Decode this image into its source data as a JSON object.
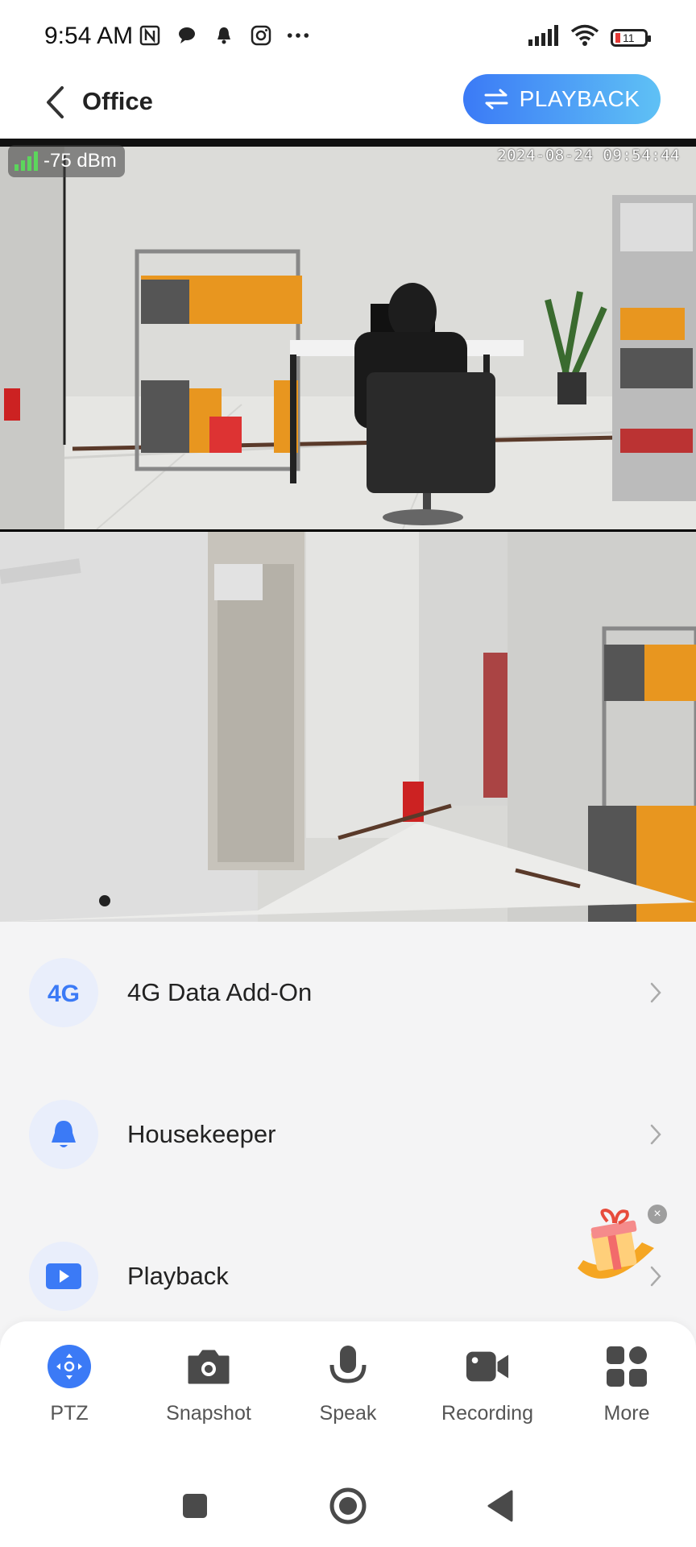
{
  "status_bar": {
    "time": "9:54 AM",
    "left_icons": [
      "nfc-icon",
      "chat-bubble-icon",
      "bell-icon",
      "instagram-icon",
      "more-dots-icon"
    ],
    "right_icons": [
      "cellular-signal-icon",
      "wifi-icon",
      "battery-icon"
    ],
    "battery_level": "11"
  },
  "header": {
    "title": "Office",
    "playback_label": "PLAYBACK",
    "accent_color": "#3b7af6"
  },
  "video": {
    "signal": "-75 dBm",
    "timestamp": "2024-08-24 09:54:44"
  },
  "menu": {
    "items": [
      {
        "label": "4G Data Add-On",
        "icon": "4g-icon"
      },
      {
        "label": "Housekeeper",
        "icon": "bell-icon"
      },
      {
        "label": "Playback",
        "icon": "play-icon"
      }
    ]
  },
  "toolbar": {
    "items": [
      {
        "label": "PTZ",
        "icon": "ptz-icon"
      },
      {
        "label": "Snapshot",
        "icon": "camera-icon"
      },
      {
        "label": "Speak",
        "icon": "microphone-icon"
      },
      {
        "label": "Recording",
        "icon": "video-record-icon"
      },
      {
        "label": "More",
        "icon": "grid-icon"
      }
    ]
  },
  "nav_bar": {
    "icons": [
      "recent-apps-icon",
      "home-icon",
      "back-icon"
    ]
  }
}
